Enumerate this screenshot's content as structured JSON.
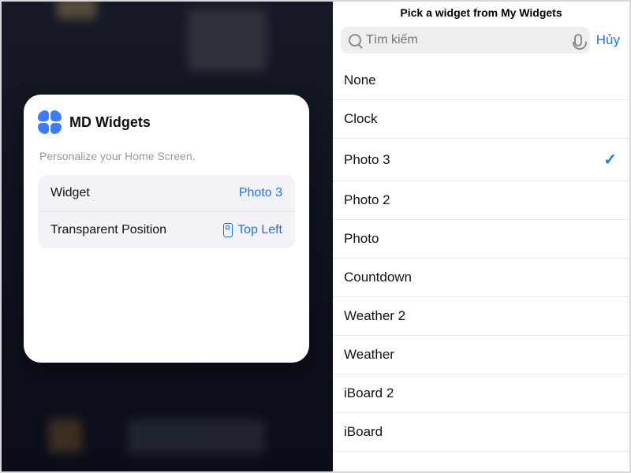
{
  "left": {
    "app_name": "MD Widgets",
    "subtitle": "Personalize your Home Screen.",
    "rows": [
      {
        "label": "Widget",
        "value": "Photo 3",
        "icon": null
      },
      {
        "label": "Transparent Position",
        "value": "Top Left",
        "icon": "phone"
      }
    ]
  },
  "right": {
    "title": "Pick a widget from My Widgets",
    "search_placeholder": "Tìm kiếm",
    "cancel_label": "Hủy",
    "selected": "Photo 3",
    "items": [
      "None",
      "Clock",
      "Photo 3",
      "Photo 2",
      "Photo",
      "Countdown",
      "Weather 2",
      "Weather",
      "iBoard 2",
      "iBoard"
    ]
  },
  "colors": {
    "accent": "#1a73ff"
  }
}
